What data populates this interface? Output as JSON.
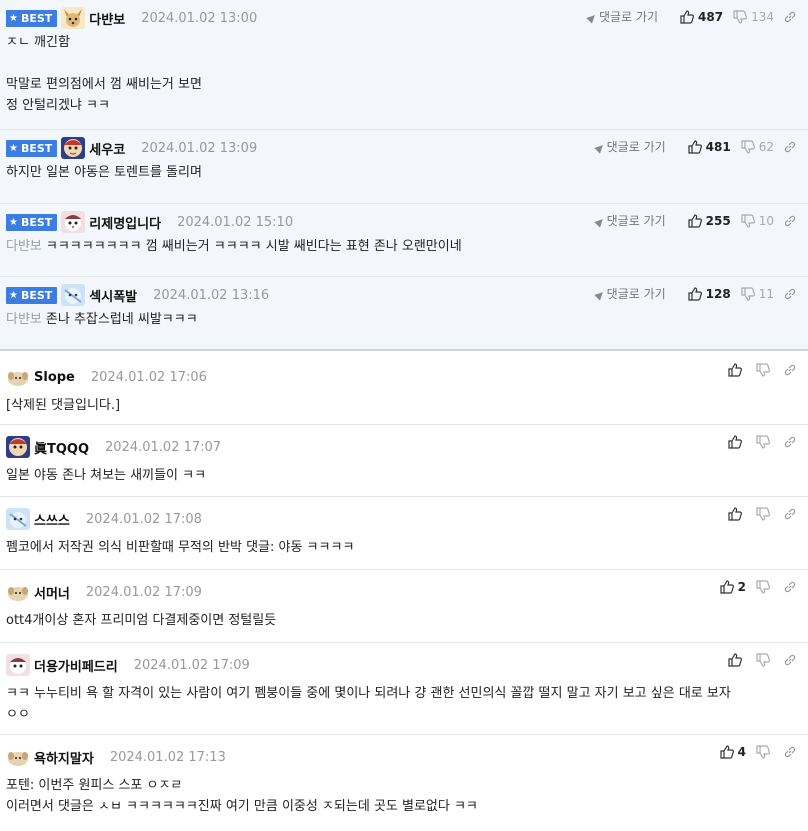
{
  "best_label": "BEST",
  "goto_label": "댓글로 가기",
  "colors": {
    "best_badge": "#3b7de0",
    "best_bg": "#f3f6fb"
  },
  "best_comments": [
    {
      "nickname": "다뱐보",
      "date": "2024.01.02 13:00",
      "up": "487",
      "down": "134",
      "lines": [
        "ㅈㄴ 깨긴함",
        "",
        "막말로 편의점에서 껌 쌔비는거 보면",
        "정 안털리겠냐 ㅋㅋ"
      ]
    },
    {
      "nickname": "세우코",
      "date": "2024.01.02 13:09",
      "up": "481",
      "down": "62",
      "lines": [
        "하지만 일본 야동은 토렌트를 돌리며"
      ]
    },
    {
      "nickname": "리제명입니다",
      "date": "2024.01.02 15:10",
      "up": "255",
      "down": "10",
      "reply_to": "다뱐보",
      "lines": [
        "ㅋㅋㅋㅋㅋㅋㅋㅋ 껌 쌔비는거 ㅋㅋㅋㅋ 시발 쌔빈다는 표현 존나 오랜만이네"
      ]
    },
    {
      "nickname": "섹시폭발",
      "date": "2024.01.02 13:16",
      "up": "128",
      "down": "11",
      "reply_to": "다뱐보",
      "lines": [
        "존나 추잡스럽네 씨발ㅋㅋㅋ"
      ]
    }
  ],
  "comments": [
    {
      "nickname": "Slope",
      "date": "2024.01.02 17:06",
      "lines": [
        "[삭제된 댓글입니다.]"
      ]
    },
    {
      "nickname": "眞TQQQ",
      "date": "2024.01.02 17:07",
      "lines": [
        "일본 야동 존나 쳐보는 새끼들이 ㅋㅋ"
      ]
    },
    {
      "nickname": "스쓰스",
      "date": "2024.01.02 17:08",
      "lines": [
        "펨코에서 저작권 의식 비판할때 무적의 반박 댓글: 야동 ㅋㅋㅋㅋ"
      ]
    },
    {
      "nickname": "서머너",
      "date": "2024.01.02 17:09",
      "up": "2",
      "lines": [
        "ott4개이상 혼자 프리미엄 다결제중이면 정털릴듯"
      ]
    },
    {
      "nickname": "더용가비페드리",
      "date": "2024.01.02 17:09",
      "lines": [
        "ㅋㅋ 누누티비 욕 할 자격이 있는 사람이 여기 펨붕이들 중에 몇이나 되려나 걍 괜한 선민의식 꼴깝 떨지 말고 자기 보고 싶은 대로 보자",
        "ㅇㅇ"
      ]
    },
    {
      "nickname": "욕하지말자",
      "date": "2024.01.02 17:13",
      "up": "4",
      "lines": [
        "포텐: 이번주 원피스 스포 ㅇㅈㄹ",
        "이러면서 댓글은 ㅅㅂ ㅋㅋㅋㅋㅋㅋ진짜 여기 만큼 이중성 ㅈ되는데 곳도 별로없다 ㅋㅋ"
      ]
    }
  ]
}
